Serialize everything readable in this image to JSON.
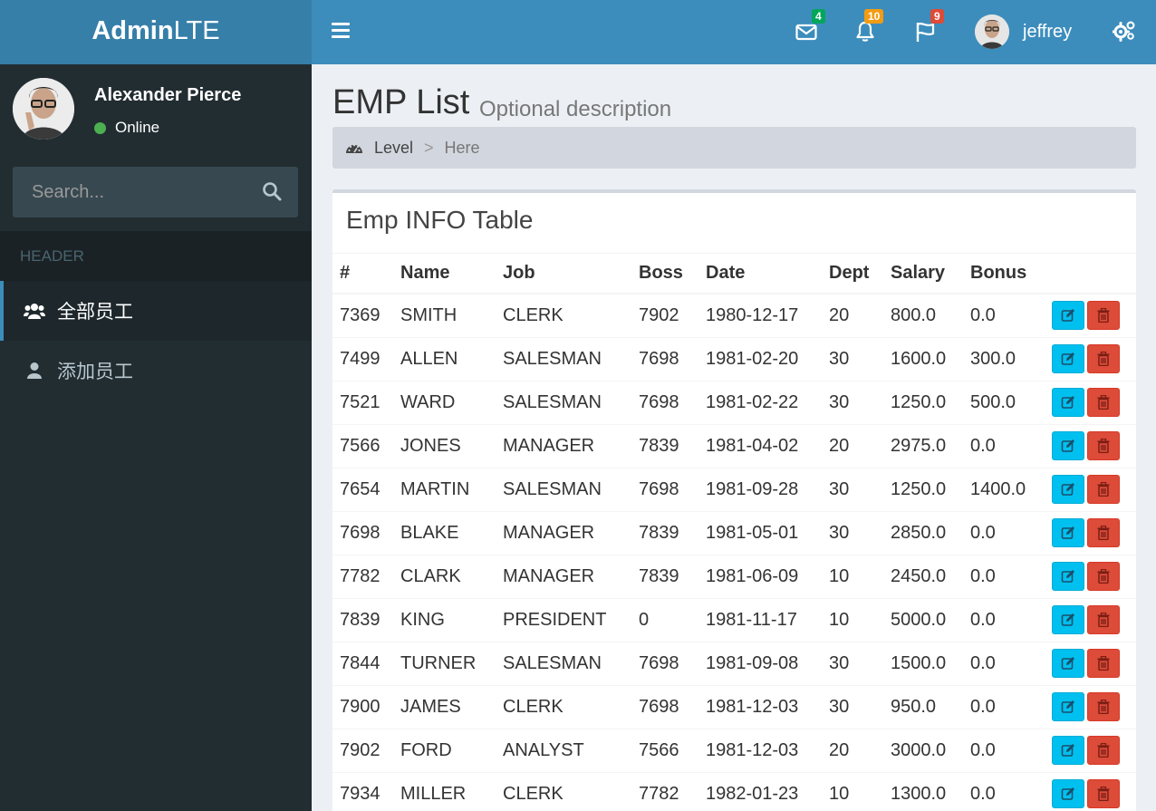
{
  "logo": {
    "bold": "Admin",
    "light": "LTE"
  },
  "navbar": {
    "messages_count": "4",
    "notifications_count": "10",
    "tasks_count": "9",
    "user_name": "jeffrey"
  },
  "sidebar": {
    "user_name": "Alexander Pierce",
    "status": "Online",
    "search_placeholder": "Search...",
    "header": "HEADER",
    "items": [
      {
        "label": "全部员工",
        "icon": "users-icon",
        "active": true
      },
      {
        "label": "添加员工",
        "icon": "user-icon",
        "active": false
      }
    ]
  },
  "content": {
    "title": "EMP List",
    "description": "Optional description",
    "breadcrumb": {
      "level": "Level",
      "separator": ">",
      "current": "Here"
    },
    "box_title": "Emp INFO Table",
    "columns": [
      "#",
      "Name",
      "Job",
      "Boss",
      "Date",
      "Dept",
      "Salary",
      "Bonus"
    ],
    "rows": [
      [
        "7369",
        "SMITH",
        "CLERK",
        "7902",
        "1980-12-17",
        "20",
        "800.0",
        "0.0"
      ],
      [
        "7499",
        "ALLEN",
        "SALESMAN",
        "7698",
        "1981-02-20",
        "30",
        "1600.0",
        "300.0"
      ],
      [
        "7521",
        "WARD",
        "SALESMAN",
        "7698",
        "1981-02-22",
        "30",
        "1250.0",
        "500.0"
      ],
      [
        "7566",
        "JONES",
        "MANAGER",
        "7839",
        "1981-04-02",
        "20",
        "2975.0",
        "0.0"
      ],
      [
        "7654",
        "MARTIN",
        "SALESMAN",
        "7698",
        "1981-09-28",
        "30",
        "1250.0",
        "1400.0"
      ],
      [
        "7698",
        "BLAKE",
        "MANAGER",
        "7839",
        "1981-05-01",
        "30",
        "2850.0",
        "0.0"
      ],
      [
        "7782",
        "CLARK",
        "MANAGER",
        "7839",
        "1981-06-09",
        "10",
        "2450.0",
        "0.0"
      ],
      [
        "7839",
        "KING",
        "PRESIDENT",
        "0",
        "1981-11-17",
        "10",
        "5000.0",
        "0.0"
      ],
      [
        "7844",
        "TURNER",
        "SALESMAN",
        "7698",
        "1981-09-08",
        "30",
        "1500.0",
        "0.0"
      ],
      [
        "7900",
        "JAMES",
        "CLERK",
        "7698",
        "1981-12-03",
        "30",
        "950.0",
        "0.0"
      ],
      [
        "7902",
        "FORD",
        "ANALYST",
        "7566",
        "1981-12-03",
        "20",
        "3000.0",
        "0.0"
      ],
      [
        "7934",
        "MILLER",
        "CLERK",
        "7782",
        "1982-01-23",
        "10",
        "1300.0",
        "0.0"
      ]
    ]
  },
  "colors": {
    "navbar": "#3c8dbc",
    "logo": "#367fa9",
    "sidebar": "#222d32",
    "edit_button": "#00c0ef",
    "delete_button": "#dd4b39"
  }
}
